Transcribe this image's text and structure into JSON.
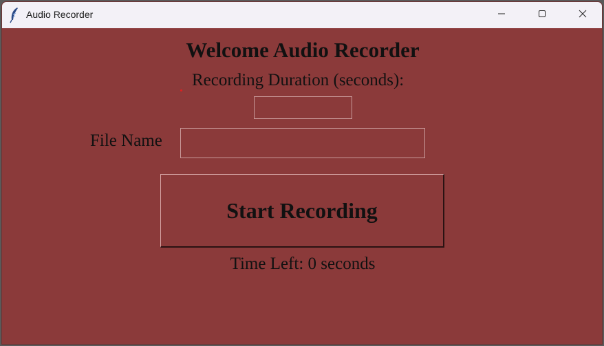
{
  "window": {
    "title": "Audio Recorder",
    "icon": "feather-icon",
    "controls": [
      "minimize-icon",
      "maximize-icon",
      "close-icon"
    ]
  },
  "app": {
    "heading": "Welcome Audio Recorder",
    "duration_label": "Recording Duration (seconds):",
    "duration_value": "",
    "file_name_label": "File Name",
    "file_name_value": "",
    "start_button_label": "Start Recording",
    "time_left": "Time Left: 0 seconds"
  },
  "colors": {
    "background": "#8b3a3a",
    "titlebar": "#f3f1f7",
    "text": "#111111"
  }
}
